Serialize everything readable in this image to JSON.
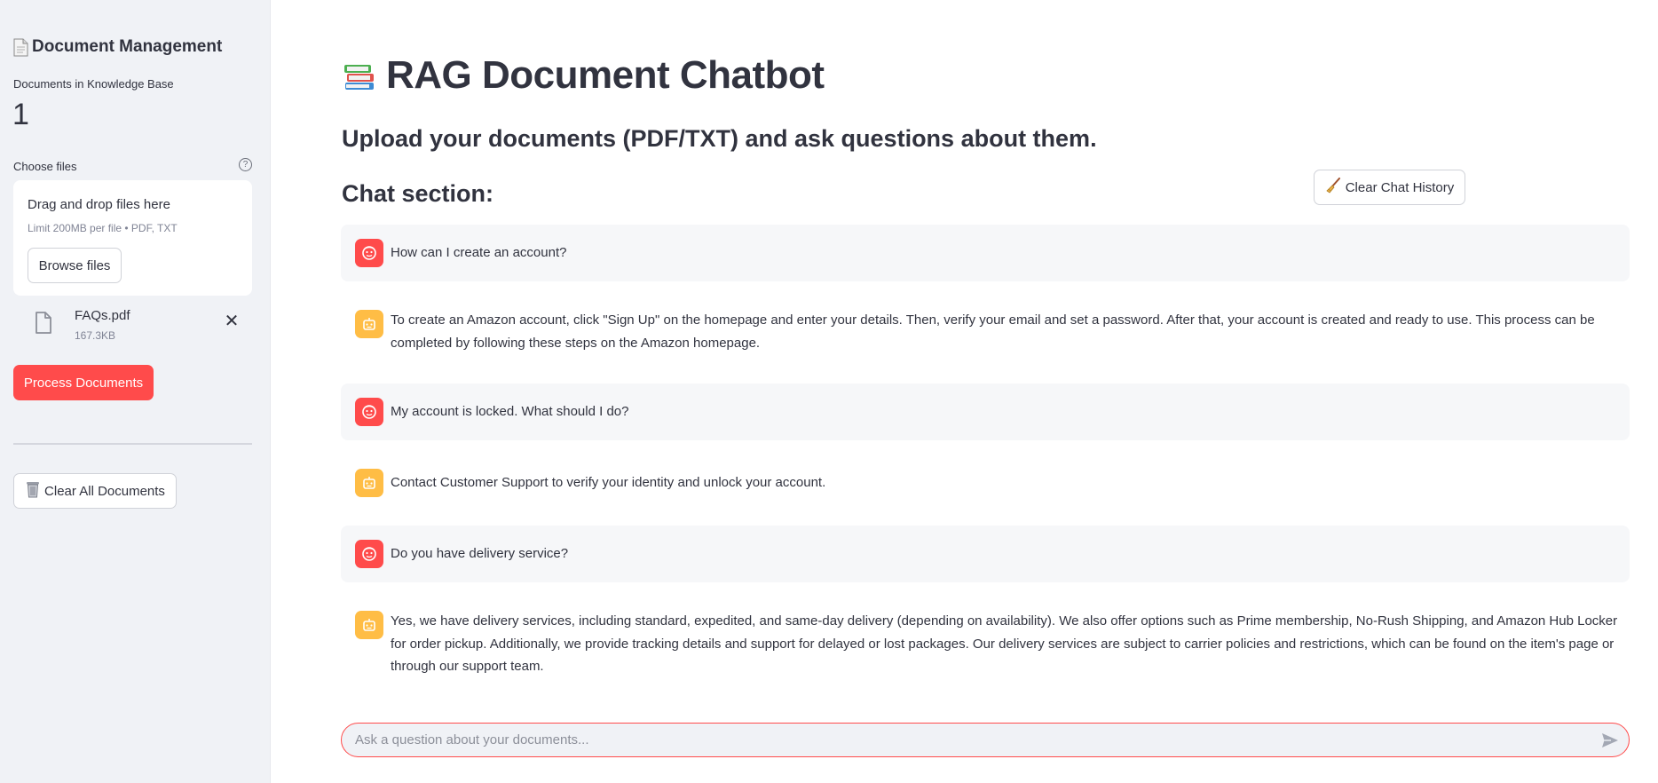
{
  "sidebar": {
    "title": "Document Management",
    "title_icon": "document-icon",
    "kb_label": "Documents in Knowledge Base",
    "kb_count": "1",
    "choose_files_label": "Choose files",
    "dropzone": {
      "title": "Drag and drop files here",
      "limit": "Limit 200MB per file • PDF, TXT",
      "browse_label": "Browse files"
    },
    "file": {
      "name": "FAQs.pdf",
      "size": "167.3KB"
    },
    "process_label": "Process Documents",
    "clear_all_label": "Clear All Documents",
    "clear_all_icon": "wastebasket-icon"
  },
  "main": {
    "title": "RAG Document Chatbot",
    "title_icon": "books-icon",
    "subtitle": "Upload your documents (PDF/TXT) and ask questions about them.",
    "chat_heading": "Chat section:",
    "clear_chat_label": "Clear Chat History",
    "clear_chat_icon": "broom-icon",
    "messages": [
      {
        "role": "user",
        "text": "How can I create an account?"
      },
      {
        "role": "assistant",
        "text": "To create an Amazon account, click \"Sign Up\" on the homepage and enter your details. Then, verify your email and set a password. After that, your account is created and ready to use. This process can be completed by following these steps on the Amazon homepage."
      },
      {
        "role": "user",
        "text": "My account is locked. What should I do?"
      },
      {
        "role": "assistant",
        "text": "Contact Customer Support to verify your identity and unlock your account."
      },
      {
        "role": "user",
        "text": "Do you have delivery service?"
      },
      {
        "role": "assistant",
        "text": "Yes, we have delivery services, including standard, expedited, and same-day delivery (depending on availability). We also offer options such as Prime membership, No-Rush Shipping, and Amazon Hub Locker for order pickup. Additionally, we provide tracking details and support for delayed or lost packages. Our delivery services are subject to carrier policies and restrictions, which can be found on the item's page or through our support team."
      }
    ],
    "chat_input": {
      "placeholder": "Ask a question about your documents...",
      "value": ""
    }
  },
  "colors": {
    "primary": "#ff4b4b",
    "assistant_avatar": "#ffbd45",
    "sidebar_bg": "#f0f2f6",
    "text": "#31333f"
  }
}
